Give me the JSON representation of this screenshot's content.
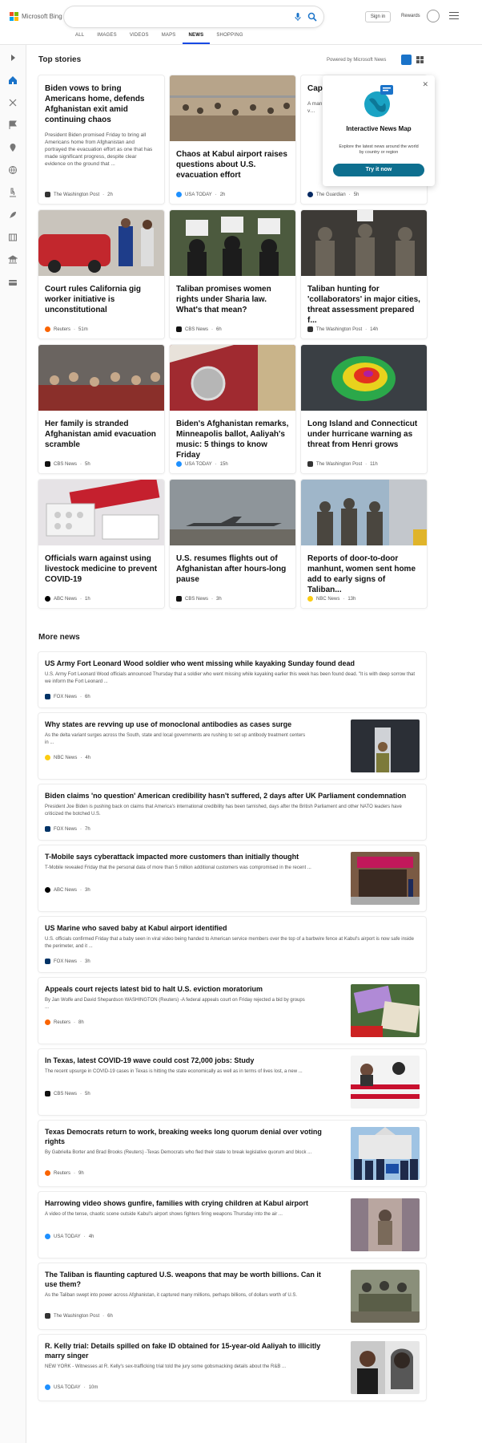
{
  "header": {
    "logo_text": "Microsoft Bing",
    "search_value": "",
    "signin_label": "Sign in",
    "rewards_label": "Rewards",
    "brand_colors": [
      "#f25022",
      "#7fba00",
      "#00a4ef",
      "#ffb900"
    ]
  },
  "tabs": [
    {
      "label": "ALL",
      "active": false
    },
    {
      "label": "IMAGES",
      "active": false
    },
    {
      "label": "VIDEOS",
      "active": false
    },
    {
      "label": "MAPS",
      "active": false
    },
    {
      "label": "NEWS",
      "active": true
    },
    {
      "label": "SHOPPING",
      "active": false
    }
  ],
  "sidebar": {
    "icons": [
      "chevron-right-icon",
      "home-icon",
      "scissors-icon",
      "flag-icon",
      "location-pin-icon",
      "globe-icon",
      "microscope-icon",
      "rocket-icon",
      "film-icon",
      "bank-icon",
      "credit-card-icon"
    ]
  },
  "top_stories": {
    "title": "Top stories",
    "powered_by": "Powered by Microsoft News",
    "cards": [
      {
        "title": "Biden vows to bring Americans home, defends Afghanistan exit amid continuing chaos",
        "snippet": "President Biden promised Friday to bring all Americans home from Afghanistan and portrayed the evacuation effort as one that has made significant progress, despite clear evidence on the ground that ...",
        "source": "The Washington Post",
        "time": "2h",
        "icon": "washington-post-icon"
      },
      {
        "title": "Chaos at Kabul airport raises questions about U.S. evacuation effort",
        "snippet": "",
        "source": "USA TODAY",
        "time": "2h",
        "icon": "usa-today-icon"
      },
      {
        "title": "Capit… charg… destr…",
        "snippet": "A man … pickup … evacua… police, … use a v…",
        "source": "The Guardian",
        "time": "5h",
        "icon": "guardian-icon"
      },
      {
        "title": "Court rules California gig worker initiative is unconstitutional",
        "source": "Reuters",
        "time": "51m",
        "icon": "reuters-icon"
      },
      {
        "title": "Taliban promises women rights under Sharia law. What's that mean?",
        "source": "CBS News",
        "time": "6h",
        "icon": "cbs-icon"
      },
      {
        "title": "Taliban hunting for 'collaborators' in major cities, threat assessment prepared f...",
        "source": "The Washington Post",
        "time": "14h",
        "icon": "washington-post-icon"
      },
      {
        "title": "Her family is stranded Afghanistan amid evacuation scramble",
        "source": "CBS News",
        "time": "5h",
        "icon": "cbs-icon"
      },
      {
        "title": "Biden's Afghanistan remarks, Minneapolis ballot, Aaliyah's music: 5 things to know Friday",
        "source": "USA TODAY",
        "time": "15h",
        "icon": "usa-today-icon"
      },
      {
        "title": "Long Island and Connecticut under hurricane warning as threat from Henri grows",
        "source": "The Washington Post",
        "time": "11h",
        "icon": "washington-post-icon"
      },
      {
        "title": "Officials warn against using livestock medicine to prevent COVID-19",
        "source": "ABC News",
        "time": "1h",
        "icon": "abc-icon"
      },
      {
        "title": "U.S. resumes flights out of Afghanistan after hours-long pause",
        "source": "CBS News",
        "time": "3h",
        "icon": "cbs-icon"
      },
      {
        "title": "Reports of door-to-door manhunt, women sent home add to early signs of Taliban...",
        "source": "NBC News",
        "time": "13h",
        "icon": "nbc-icon"
      }
    ]
  },
  "popup": {
    "title": "Interactive News Map",
    "description": "Explore the latest news around the world by country or region",
    "button": "Try it now",
    "close": "✕"
  },
  "more_news": {
    "title": "More news",
    "items": [
      {
        "title": "US Army Fort Leonard Wood soldier who went missing while kayaking Sunday found dead",
        "snippet": "U.S. Army Fort Leonard Wood officials announced Thursday that a soldier who went missing while kayaking earlier this week has been found dead. \"It is with deep sorrow that we inform the Fort Leonard ...",
        "source": "FOX News",
        "time": "6h",
        "has_image": false
      },
      {
        "title": "Why states are revving up use of monoclonal antibodies as cases surge",
        "snippet": "As the delta variant surges across the South, state and local governments are rushing to set up antibody treatment centers in ...",
        "source": "NBC News",
        "time": "4h",
        "has_image": true
      },
      {
        "title": "Biden claims 'no question' American credibility hasn't suffered, 2 days after UK Parliament condemnation",
        "snippet": "President Joe Biden is pushing back on claims that America's international credibility has been tarnished, days after the British Parliament and other NATO leaders have criticized the botched U.S.",
        "source": "FOX News",
        "time": "7h",
        "has_image": false
      },
      {
        "title": "T-Mobile says cyberattack impacted more customers than initially thought",
        "snippet": "T-Mobile revealed Friday that the personal data of more than 5 million additional customers was compromised in the recent ...",
        "source": "ABC News",
        "time": "3h",
        "has_image": true
      },
      {
        "title": "US Marine who saved baby at Kabul airport identified",
        "snippet": "U.S. officials confirmed Friday that a baby seen in viral video being handed to American service members over the top of a barbwire fence at Kabul's airport is now safe inside the perimeter, and it ...",
        "source": "FOX News",
        "time": "3h",
        "has_image": false
      },
      {
        "title": "Appeals court rejects latest bid to halt U.S. eviction moratorium",
        "snippet": "By Jan Wolfe and David Shepardson WASHINGTON (Reuters) -A federal appeals court on Friday rejected a bid by groups ...",
        "source": "Reuters",
        "time": "8h",
        "has_image": true
      },
      {
        "title": "In Texas, latest COVID-19 wave could cost 72,000 jobs: Study",
        "snippet": "The recent upsurge in COVID-19 cases in Texas is hitting the state economically as well as in terms of lives lost, a new ...",
        "source": "CBS News",
        "time": "5h",
        "has_image": true
      },
      {
        "title": "Texas Democrats return to work, breaking weeks long quorum denial over voting rights",
        "snippet": "By Gabriella Borter and Brad Brooks (Reuters) -Texas Democrats who fled their state to break legislative quorum and block ...",
        "source": "Reuters",
        "time": "9h",
        "has_image": true
      },
      {
        "title": "Harrowing video shows gunfire, families with crying children at Kabul airport",
        "snippet": "A video of the tense, chaotic scene outside Kabul's airport shows fighters firing weapons Thursday into the air ...",
        "source": "USA TODAY",
        "time": "4h",
        "has_image": true
      },
      {
        "title": "The Taliban is flaunting captured U.S. weapons that may be worth billions. Can it use them?",
        "snippet": "As the Taliban swept into power across Afghanistan, it captured many millions, perhaps billions, of dollars worth of U.S.",
        "source": "The Washington Post",
        "time": "6h",
        "has_image": true
      },
      {
        "title": "R. Kelly trial: Details spilled on fake ID obtained for 15-year-old Aaliyah to illicitly marry singer",
        "snippet": "NEW YORK - Witnesses at R. Kelly's sex-trafficking trial told the jury some gobsmacking details about the R&B ...",
        "source": "USA TODAY",
        "time": "10m",
        "has_image": true
      }
    ]
  }
}
